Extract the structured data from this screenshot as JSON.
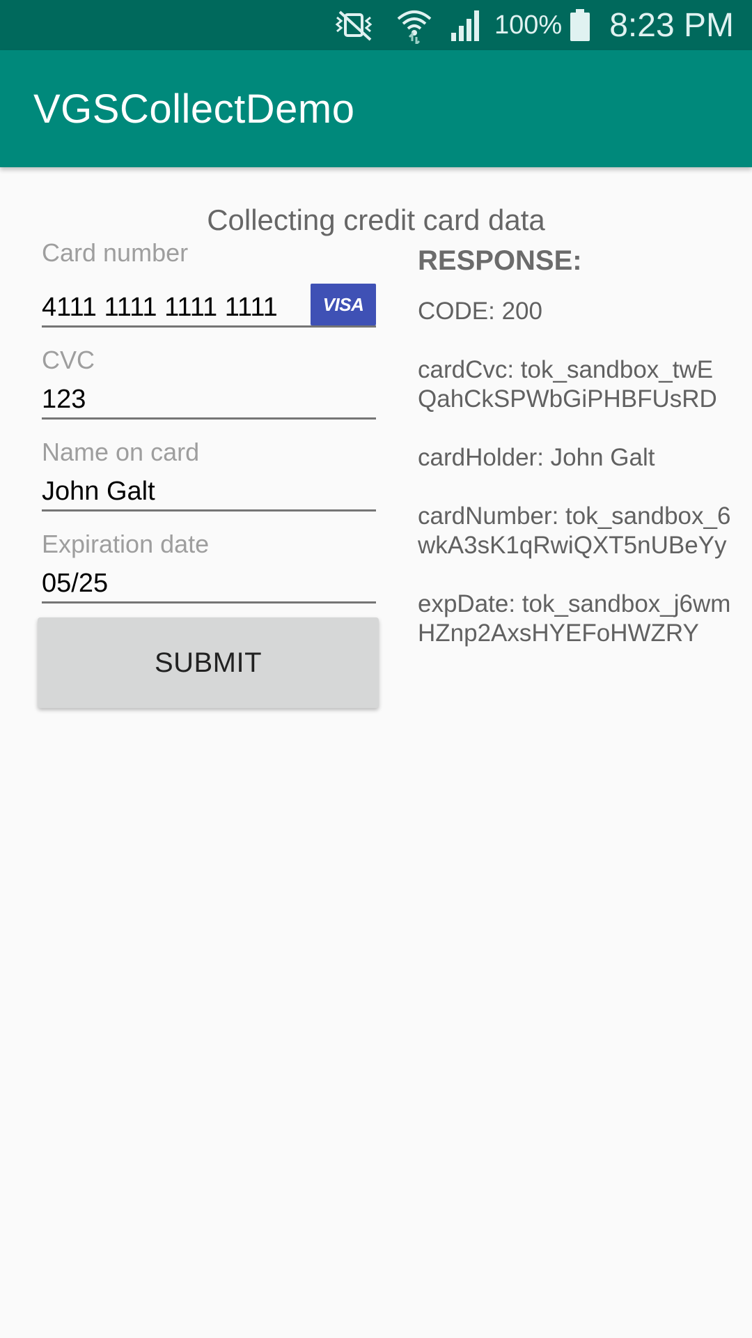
{
  "status_bar": {
    "icons": [
      "vibrate-mute-icon",
      "wifi-icon",
      "signal-icon",
      "battery-icon"
    ],
    "battery": "100%",
    "time": "8:23 PM"
  },
  "app_bar": {
    "title": "VGSCollectDemo",
    "color": "#00897b"
  },
  "subtitle": "Collecting credit card data",
  "form": {
    "card_number": {
      "label": "Card number",
      "value": "4111 1111 1111 1111",
      "brand": "VISA"
    },
    "cvc": {
      "label": "CVC",
      "value": "123"
    },
    "name": {
      "label": "Name on card",
      "value": "John Galt"
    },
    "exp": {
      "label": "Expiration date",
      "value": "05/25"
    },
    "submit_label": "SUBMIT"
  },
  "response": {
    "heading": "RESPONSE:",
    "lines": [
      "CODE: 200",
      "cardCvc: tok_sandbox_twEQahCkSPWbGiPHBFUsRD",
      "cardHolder: John Galt",
      "cardNumber: tok_sandbox_6wkA3sK1qRwiQXT5nUBeYy",
      "expDate: tok_sandbox_j6wmHZnp2AxsHYEFoHWZRY"
    ]
  }
}
